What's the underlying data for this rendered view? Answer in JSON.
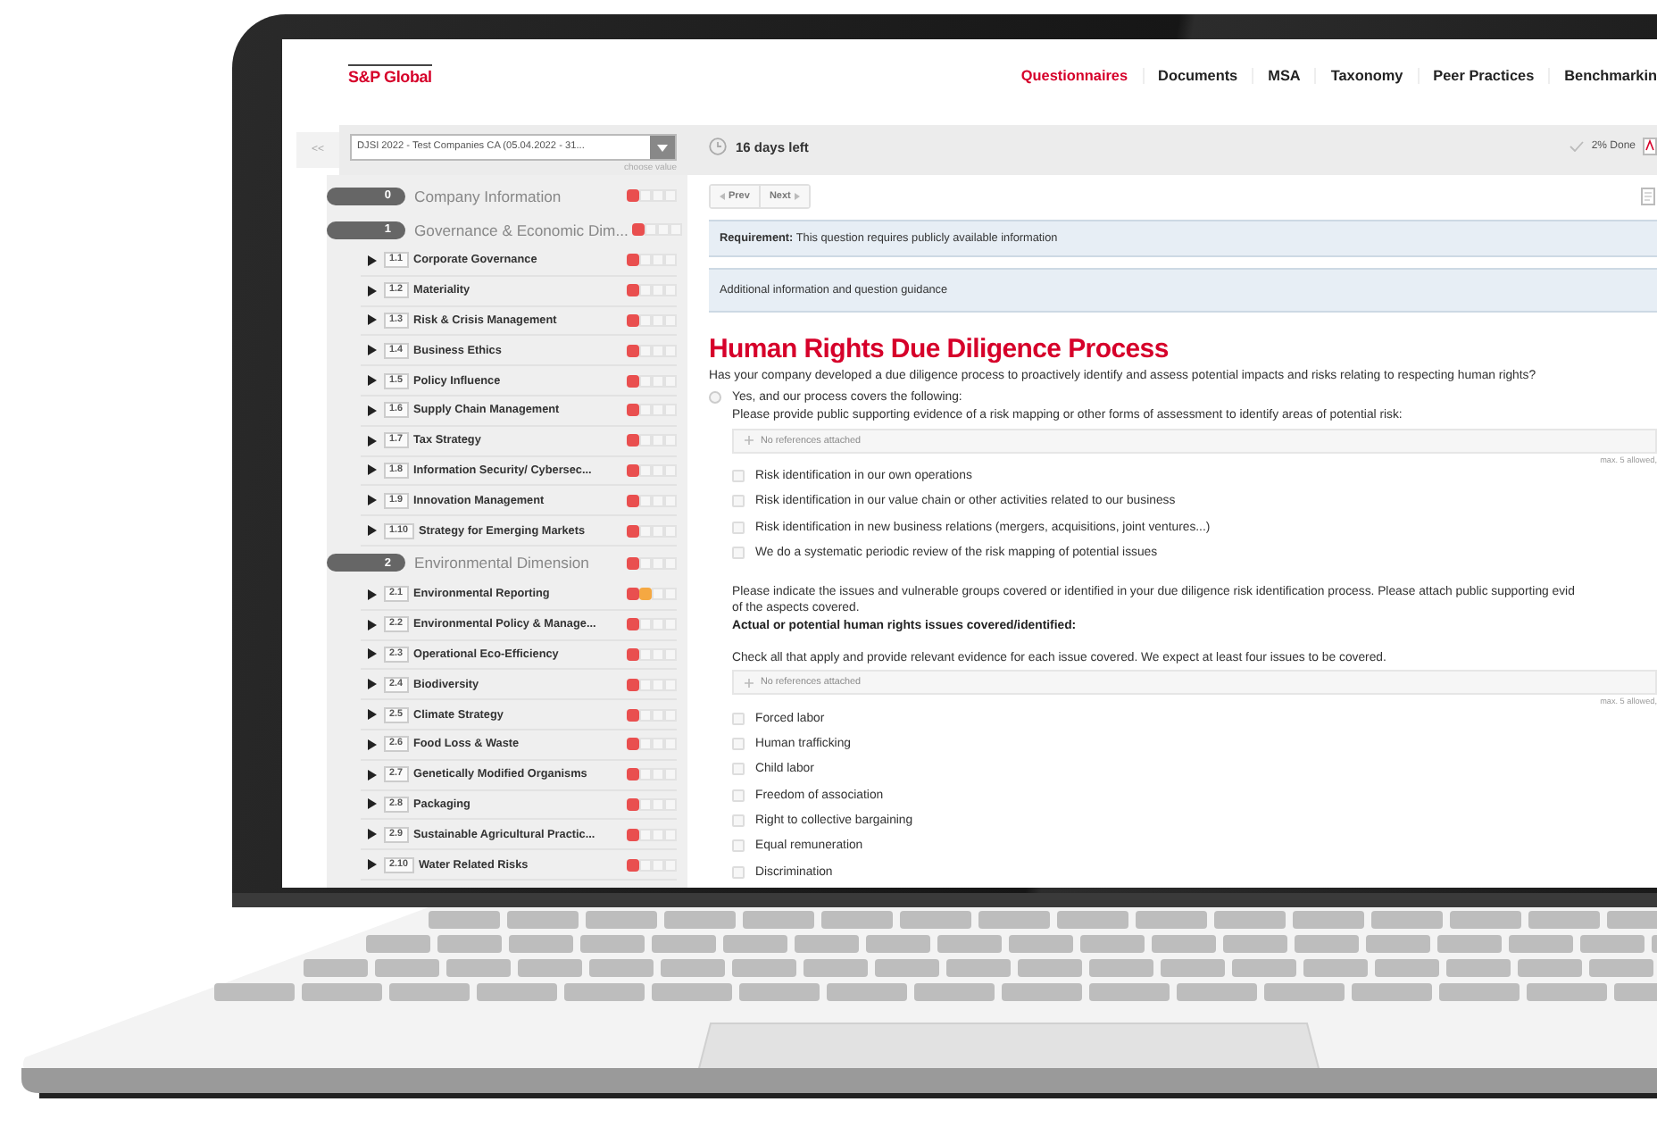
{
  "header": {
    "logo": "S&P Global",
    "nav": [
      {
        "label": "Questionnaires",
        "selected": true
      },
      {
        "label": "Documents",
        "selected": false
      },
      {
        "label": "MSA",
        "selected": false
      },
      {
        "label": "Taxonomy",
        "selected": false
      },
      {
        "label": "Peer Practices",
        "selected": false
      },
      {
        "label": "Benchmarkin",
        "selected": false
      }
    ]
  },
  "toolbar": {
    "collapse": "<<",
    "questionnaire": {
      "value": "DJSI 2022 - Test Companies CA (05.04.2022 - 31...",
      "hint": "choose value"
    },
    "time_left": "16 days left",
    "progress": "2% Done"
  },
  "sidebar": {
    "sections": [
      {
        "number": "0",
        "title": "Company Information",
        "steps": [
          {
            "filled": true,
            "color": "#e94f4f"
          },
          {
            "filled": false
          },
          {
            "filled": false
          },
          {
            "filled": false
          }
        ]
      },
      {
        "number": "1",
        "title": "Governance & Economic Dim...",
        "steps": [
          {
            "filled": true,
            "color": "#e94f4f"
          },
          {
            "filled": false
          },
          {
            "filled": false
          },
          {
            "filled": false
          }
        ],
        "children": [
          {
            "number": "1.1",
            "title": "Corporate Governance",
            "steps": [
              {
                "filled": true,
                "color": "#e94f4f"
              },
              {
                "filled": false
              },
              {
                "filled": false
              },
              {
                "filled": false
              }
            ]
          },
          {
            "number": "1.2",
            "title": "Materiality",
            "steps": [
              {
                "filled": true,
                "color": "#e94f4f"
              },
              {
                "filled": false
              },
              {
                "filled": false
              },
              {
                "filled": false
              }
            ]
          },
          {
            "number": "1.3",
            "title": "Risk & Crisis Management",
            "steps": [
              {
                "filled": true,
                "color": "#e94f4f"
              },
              {
                "filled": false
              },
              {
                "filled": false
              },
              {
                "filled": false
              }
            ]
          },
          {
            "number": "1.4",
            "title": "Business Ethics",
            "steps": [
              {
                "filled": true,
                "color": "#e94f4f"
              },
              {
                "filled": false
              },
              {
                "filled": false
              },
              {
                "filled": false
              }
            ]
          },
          {
            "number": "1.5",
            "title": "Policy Influence",
            "steps": [
              {
                "filled": true,
                "color": "#e94f4f"
              },
              {
                "filled": false
              },
              {
                "filled": false
              },
              {
                "filled": false
              }
            ]
          },
          {
            "number": "1.6",
            "title": "Supply Chain Management",
            "steps": [
              {
                "filled": true,
                "color": "#e94f4f"
              },
              {
                "filled": false
              },
              {
                "filled": false
              },
              {
                "filled": false
              }
            ]
          },
          {
            "number": "1.7",
            "title": "Tax Strategy",
            "steps": [
              {
                "filled": true,
                "color": "#e94f4f"
              },
              {
                "filled": false
              },
              {
                "filled": false
              },
              {
                "filled": false
              }
            ]
          },
          {
            "number": "1.8",
            "title": "Information Security/ Cybersec...",
            "steps": [
              {
                "filled": true,
                "color": "#e94f4f"
              },
              {
                "filled": false
              },
              {
                "filled": false
              },
              {
                "filled": false
              }
            ]
          },
          {
            "number": "1.9",
            "title": "Innovation Management",
            "steps": [
              {
                "filled": true,
                "color": "#e94f4f"
              },
              {
                "filled": false
              },
              {
                "filled": false
              },
              {
                "filled": false
              }
            ]
          },
          {
            "number": "1.10",
            "title": "Strategy for Emerging Markets",
            "steps": [
              {
                "filled": true,
                "color": "#e94f4f"
              },
              {
                "filled": false
              },
              {
                "filled": false
              },
              {
                "filled": false
              }
            ]
          }
        ]
      },
      {
        "number": "2",
        "title": "Environmental Dimension",
        "steps": [
          {
            "filled": true,
            "color": "#e94f4f"
          },
          {
            "filled": false
          },
          {
            "filled": false
          },
          {
            "filled": false
          }
        ],
        "children": [
          {
            "number": "2.1",
            "title": "Environmental Reporting",
            "steps": [
              {
                "filled": true,
                "color": "#e94f4f"
              },
              {
                "filled": true,
                "color": "#f5a842"
              },
              {
                "filled": false
              },
              {
                "filled": false
              }
            ]
          },
          {
            "number": "2.2",
            "title": "Environmental Policy & Manage...",
            "steps": [
              {
                "filled": true,
                "color": "#e94f4f"
              },
              {
                "filled": false
              },
              {
                "filled": false
              },
              {
                "filled": false
              }
            ]
          },
          {
            "number": "2.3",
            "title": "Operational Eco-Efficiency",
            "steps": [
              {
                "filled": true,
                "color": "#e94f4f"
              },
              {
                "filled": false
              },
              {
                "filled": false
              },
              {
                "filled": false
              }
            ]
          },
          {
            "number": "2.4",
            "title": "Biodiversity",
            "steps": [
              {
                "filled": true,
                "color": "#e94f4f"
              },
              {
                "filled": false
              },
              {
                "filled": false
              },
              {
                "filled": false
              }
            ]
          },
          {
            "number": "2.5",
            "title": "Climate Strategy",
            "steps": [
              {
                "filled": true,
                "color": "#e94f4f"
              },
              {
                "filled": false
              },
              {
                "filled": false
              },
              {
                "filled": false
              }
            ]
          },
          {
            "number": "2.6",
            "title": "Food Loss & Waste",
            "steps": [
              {
                "filled": true,
                "color": "#e94f4f"
              },
              {
                "filled": false
              },
              {
                "filled": false
              },
              {
                "filled": false
              }
            ]
          },
          {
            "number": "2.7",
            "title": "Genetically Modified Organisms",
            "steps": [
              {
                "filled": true,
                "color": "#e94f4f"
              },
              {
                "filled": false
              },
              {
                "filled": false
              },
              {
                "filled": false
              }
            ]
          },
          {
            "number": "2.8",
            "title": "Packaging",
            "steps": [
              {
                "filled": true,
                "color": "#e94f4f"
              },
              {
                "filled": false
              },
              {
                "filled": false
              },
              {
                "filled": false
              }
            ]
          },
          {
            "number": "2.9",
            "title": "Sustainable Agricultural Practic...",
            "steps": [
              {
                "filled": true,
                "color": "#e94f4f"
              },
              {
                "filled": false
              },
              {
                "filled": false
              },
              {
                "filled": false
              }
            ]
          },
          {
            "number": "2.10",
            "title": "Water Related Risks",
            "steps": [
              {
                "filled": true,
                "color": "#e94f4f"
              },
              {
                "filled": false
              },
              {
                "filled": false
              },
              {
                "filled": false
              }
            ]
          }
        ]
      }
    ]
  },
  "main": {
    "pager": [
      {
        "label": "Prev"
      },
      {
        "label": "Next"
      }
    ],
    "requirement": "**Requirement:** This question requires publicly available information",
    "guidance": "Additional information and question guidance",
    "question": {
      "title": "Human Rights Due Diligence Process",
      "text": "Has your company developed a due diligence process to proactively identify and assess potential impacts and risks relating to respecting human rights?",
      "options": [
        {
          "label": "Yes, and our process covers the following:",
          "selected": false,
          "parts": [
            {
              "kind": "instruction",
              "text": "Please provide public supporting evidence of a risk mapping or other forms of assessment to identify areas of potential risk:"
            },
            {
              "kind": "attachments",
              "placeholder": "No references attached",
              "limit": "max. 5 allowed,"
            },
            {
              "kind": "checkbox",
              "label": "Risk identification in our own operations",
              "checked": false
            },
            {
              "kind": "checkbox",
              "label": "Risk identification in our value chain or other activities related to our business",
              "checked": false
            },
            {
              "kind": "checkbox",
              "label": "Risk identification in new business relations (mergers, acquisitions, joint ventures...)",
              "checked": false
            },
            {
              "kind": "checkbox",
              "label": "We do a systematic periodic review of the risk mapping of potential issues",
              "checked": false
            },
            {
              "kind": "instruction",
              "text": "Please indicate the issues and vulnerable groups covered or identified in your due diligence risk identification process. Please attach public supporting evid\nof the aspects covered."
            },
            {
              "kind": "heading",
              "text": "Actual or potential human rights issues covered/identified:"
            },
            {
              "kind": "instruction",
              "text": "Check all that apply and provide relevant evidence for each issue covered. We expect at least four issues to be covered."
            },
            {
              "kind": "attachments",
              "placeholder": "No references attached",
              "limit": "max. 5 allowed,"
            },
            {
              "kind": "checkbox",
              "label": "Forced labor",
              "checked": false
            },
            {
              "kind": "checkbox",
              "label": "Human trafficking",
              "checked": false
            },
            {
              "kind": "checkbox",
              "label": "Child labor",
              "checked": false
            },
            {
              "kind": "checkbox",
              "label": "Freedom of association",
              "checked": false
            },
            {
              "kind": "checkbox",
              "label": "Right to collective bargaining",
              "checked": false
            },
            {
              "kind": "checkbox",
              "label": "Equal remuneration",
              "checked": false
            },
            {
              "kind": "checkbox",
              "label": "Discrimination",
              "checked": false
            }
          ]
        }
      ]
    }
  }
}
